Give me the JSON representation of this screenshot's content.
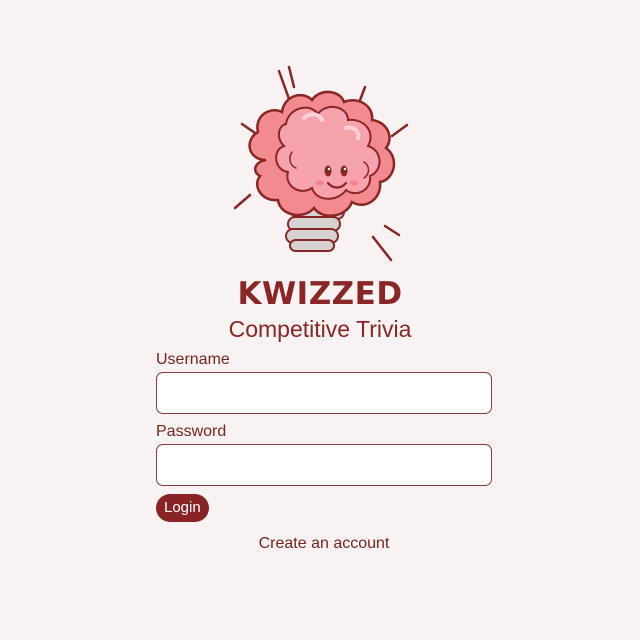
{
  "app": {
    "brand_name": "KWIZZED",
    "tagline": "Competitive Trivia",
    "logo_icon": "brain-lightbulb-icon"
  },
  "login_form": {
    "username_label": "Username",
    "username_value": "",
    "password_label": "Password",
    "password_value": "",
    "login_button_label": "Login"
  },
  "footer": {
    "create_account_link": "Create an account"
  },
  "colors": {
    "background": "#f8f3f2",
    "primary": "#8a2424",
    "brain_pink": "#f7a3ae",
    "input_background": "#ffffff"
  }
}
